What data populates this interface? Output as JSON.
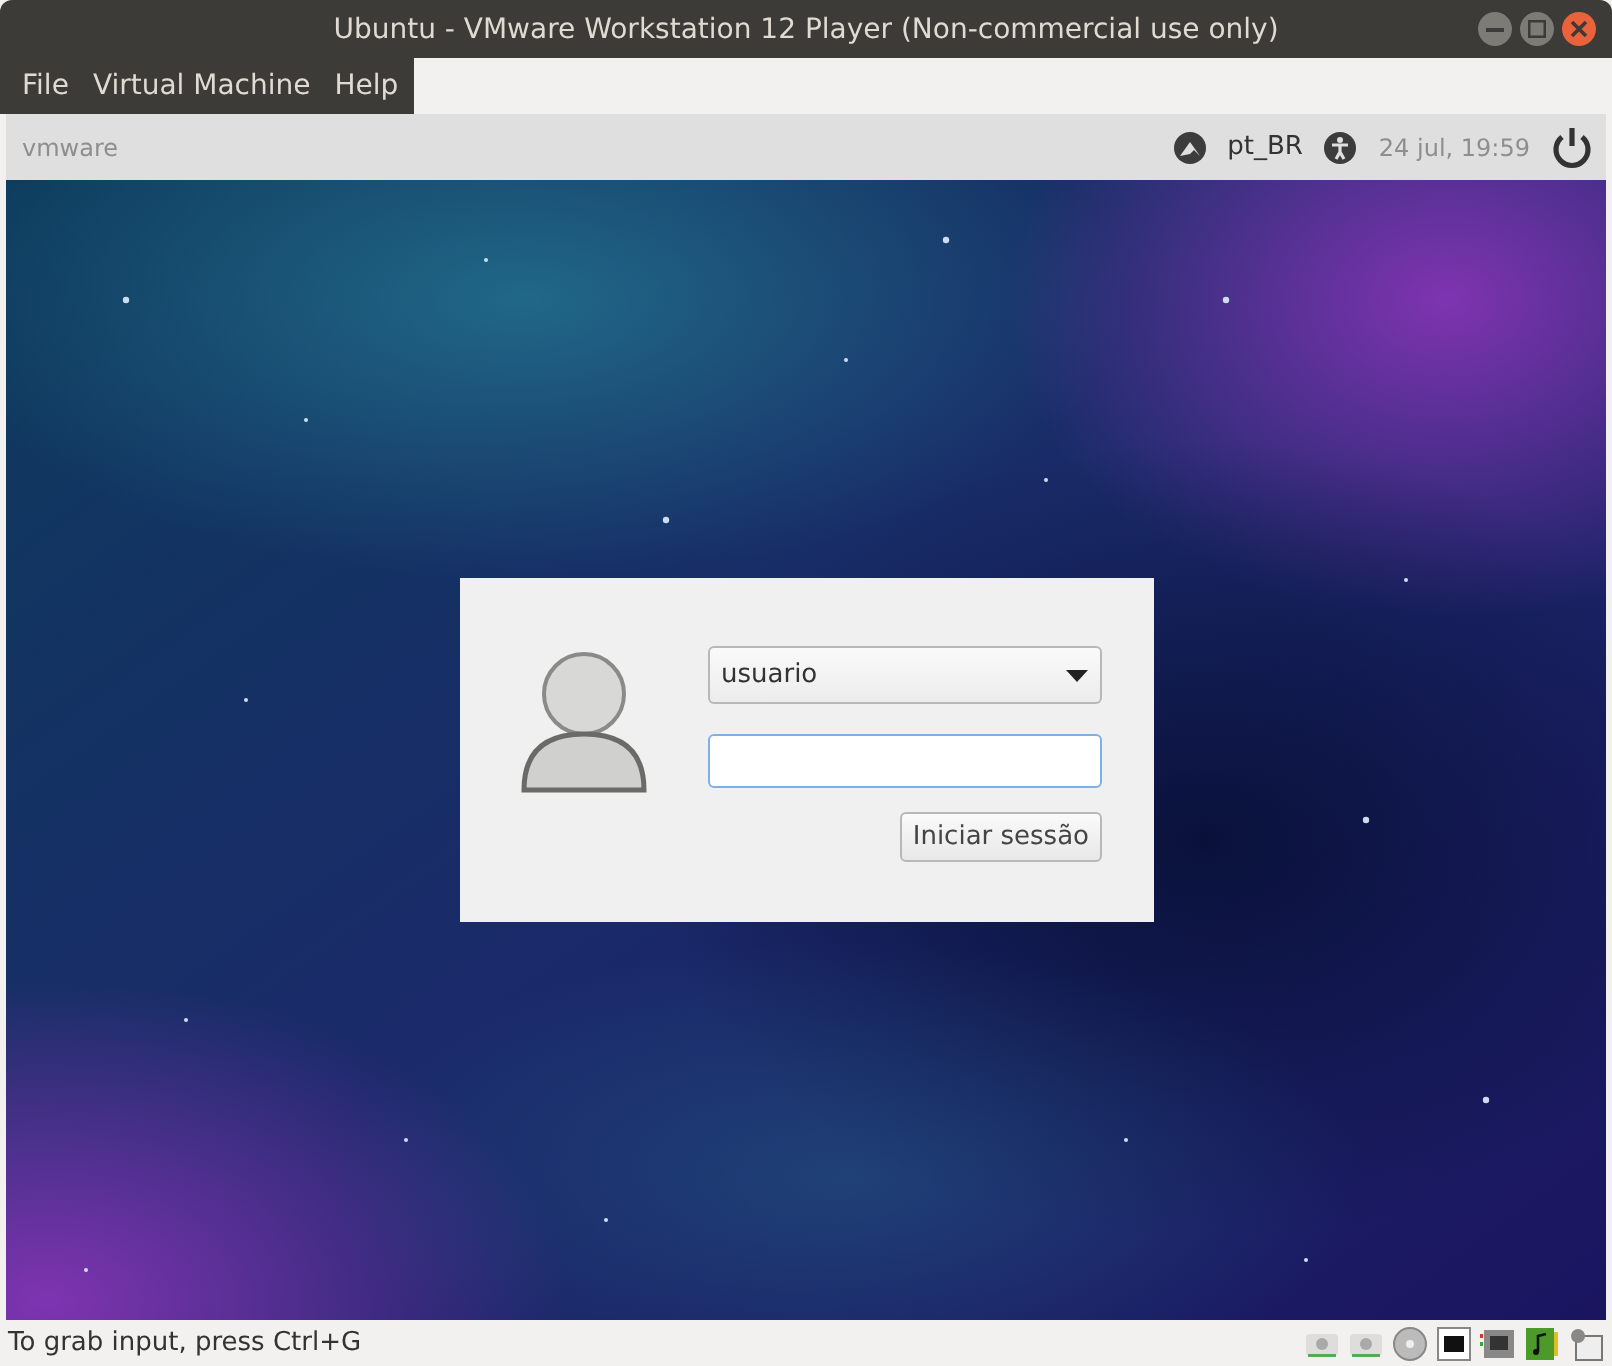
{
  "window": {
    "title": "Ubuntu - VMware Workstation 12 Player (Non-commercial use only)"
  },
  "menu": [
    {
      "label": "File"
    },
    {
      "label": "Virtual Machine"
    },
    {
      "label": "Help"
    }
  ],
  "guest_panel": {
    "brand": "vmware",
    "language": "pt_BR",
    "clock": "24 jul, 19:59"
  },
  "login": {
    "user": "usuario",
    "button": "Iniciar sessão"
  },
  "status_bar": {
    "message": "To grab input, press Ctrl+G"
  }
}
